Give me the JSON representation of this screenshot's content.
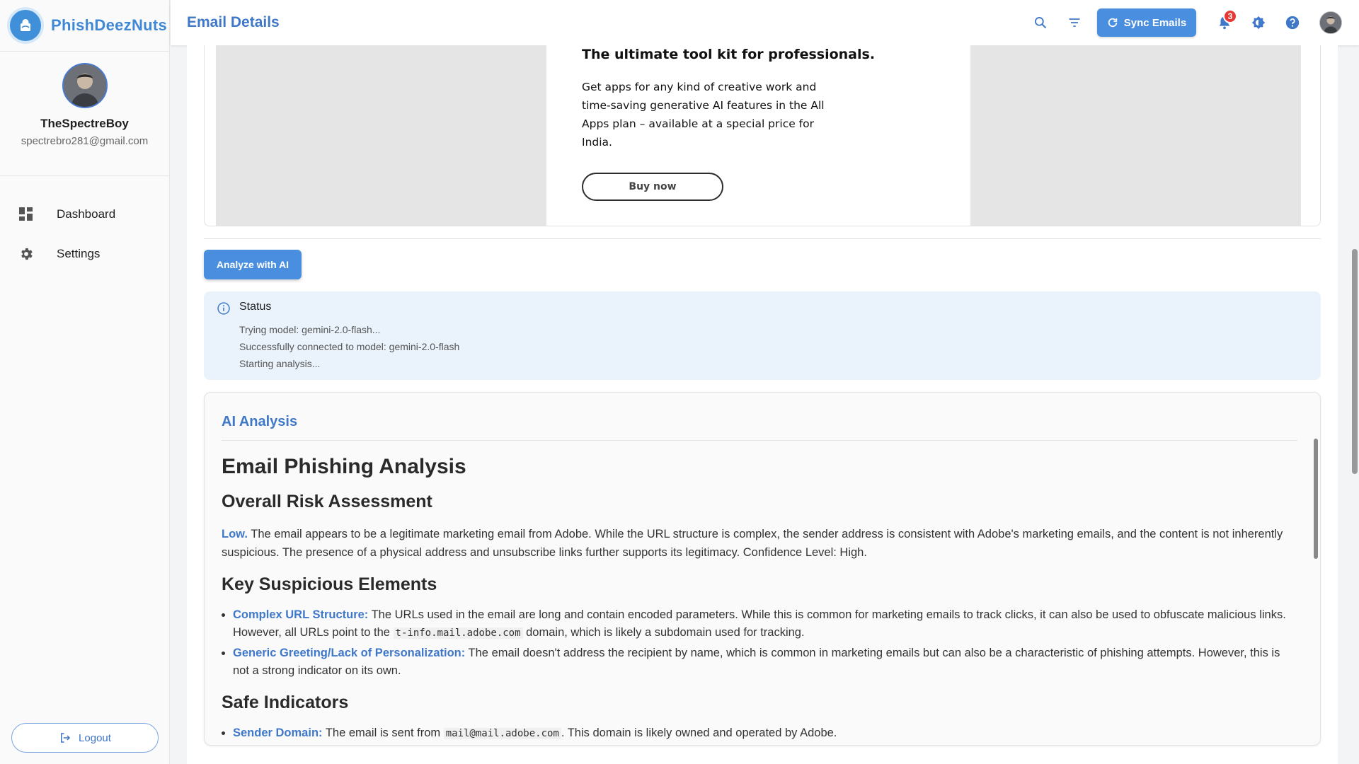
{
  "brand": {
    "name": "PhishDeezNuts"
  },
  "profile": {
    "name": "TheSpectreBoy",
    "email": "spectrebro281@gmail.com"
  },
  "nav": {
    "dashboard_label": "Dashboard",
    "settings_label": "Settings",
    "logout_label": "Logout"
  },
  "header": {
    "title": "Email Details",
    "sync_label": "Sync Emails",
    "notification_count": "3"
  },
  "email_preview": {
    "headline": "The ultimate tool kit for professionals.",
    "body": "Get apps for any kind of creative work and time-saving generative AI features in the All Apps plan – available at a special price for India.",
    "button_label": "Buy now"
  },
  "analyze": {
    "button_label": "Analyze with AI"
  },
  "status": {
    "title": "Status",
    "lines": [
      "Trying model: gemini-2.0-flash...",
      "Successfully connected to model: gemini-2.0-flash",
      "Starting analysis..."
    ]
  },
  "analysis": {
    "card_title": "AI Analysis",
    "heading": "Email Phishing Analysis",
    "risk_heading": "Overall Risk Assessment",
    "risk_level": "Low.",
    "risk_text": " The email appears to be a legitimate marketing email from Adobe. While the URL structure is complex, the sender address is consistent with Adobe's marketing emails, and the content is not inherently suspicious. The presence of a physical address and unsubscribe links further supports its legitimacy. Confidence Level: High.",
    "suspicious_heading": "Key Suspicious Elements",
    "suspicious": [
      {
        "label": "Complex URL Structure:",
        "text_before": " The URLs used in the email are long and contain encoded parameters. While this is common for marketing emails to track clicks, it can also be used to obfuscate malicious links. However, all URLs point to the ",
        "code": "t-info.mail.adobe.com",
        "text_after": " domain, which is likely a subdomain used for tracking."
      },
      {
        "label": "Generic Greeting/Lack of Personalization:",
        "text_before": " The email doesn't address the recipient by name, which is common in marketing emails but can also be a characteristic of phishing attempts. However, this is not a strong indicator on its own.",
        "code": "",
        "text_after": ""
      }
    ],
    "safe_heading": "Safe Indicators",
    "safe": [
      {
        "label": "Sender Domain:",
        "text_before": " The email is sent from ",
        "code": "mail@mail.adobe.com",
        "text_after": ". This domain is likely owned and operated by Adobe."
      }
    ]
  },
  "colors": {
    "accent": "#4a8ee0",
    "title": "#3f78c9",
    "status_bg": "#eaf3fc",
    "badge": "#e53935"
  }
}
